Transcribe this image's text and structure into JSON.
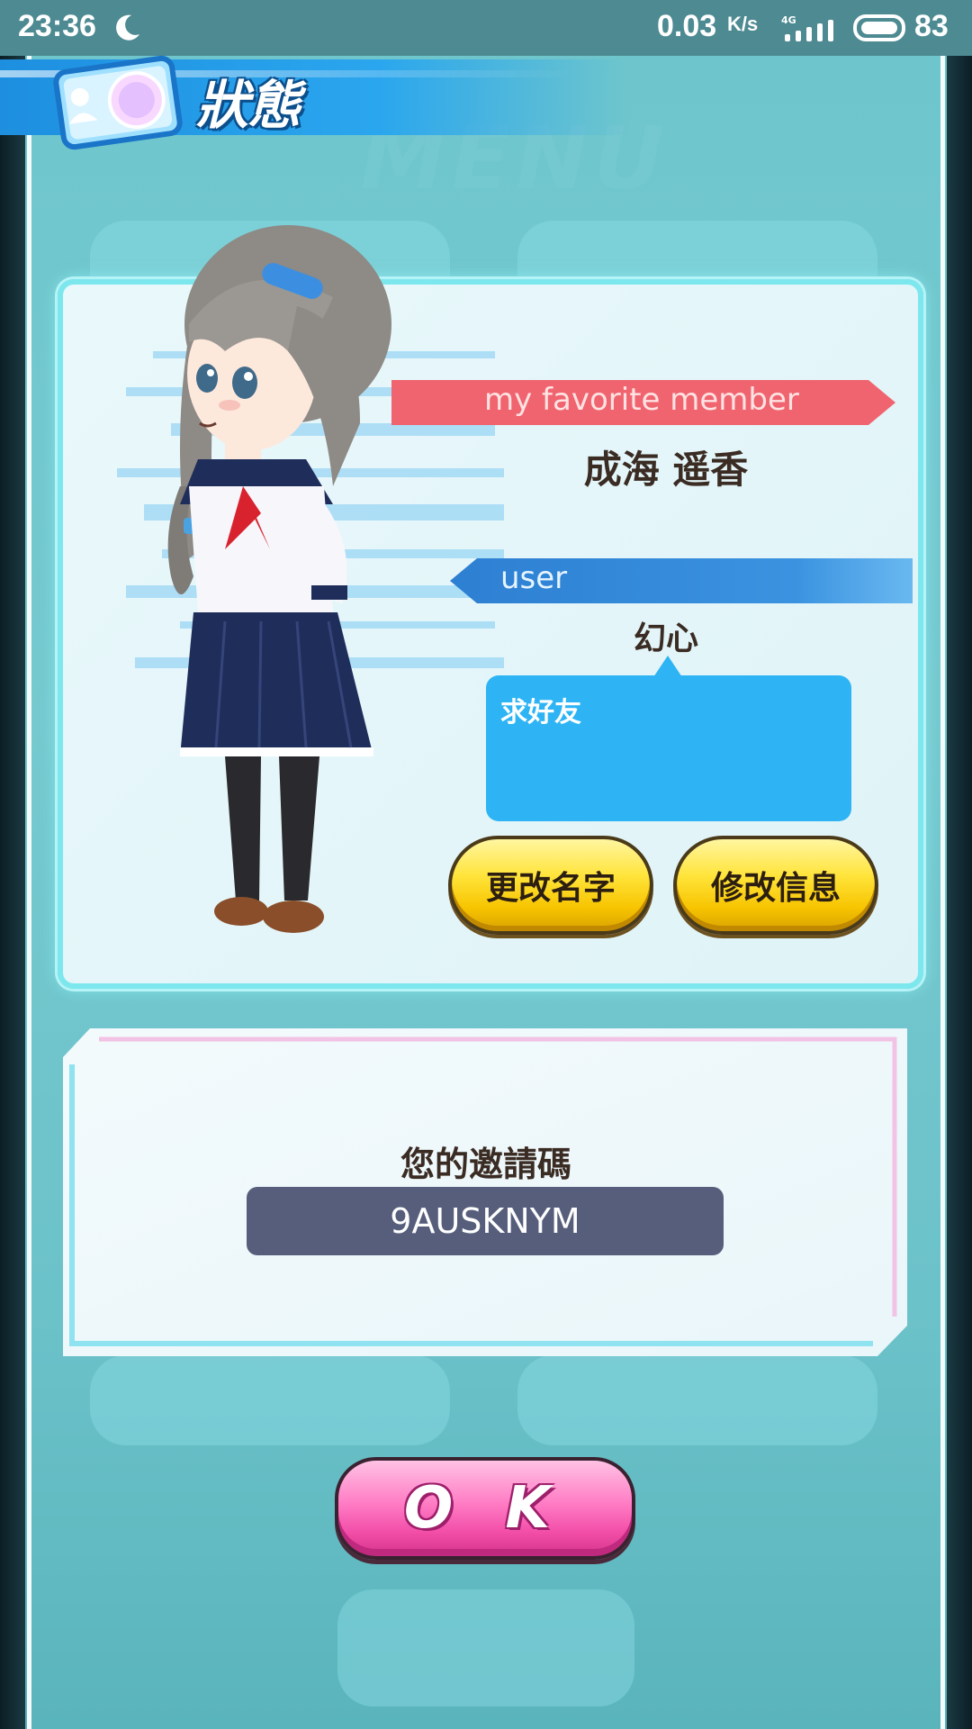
{
  "status_bar": {
    "time": "23:36",
    "speed": "0.03",
    "speed_unit": "K/s",
    "battery": "83"
  },
  "header": {
    "title": "狀態"
  },
  "profile": {
    "favorite_label": "my favorite member",
    "favorite_name": "成海 遥香",
    "user_label": "user",
    "user_name": "幻心",
    "message": "求好友",
    "change_name_button": "更改名字",
    "edit_info_button": "修改信息"
  },
  "invite": {
    "title": "您的邀請碼",
    "code": "9AUSKNYM"
  },
  "ok_button": "O K",
  "colors": {
    "favorite_banner": "#f06470",
    "user_banner": "#2d7fd2",
    "message_bubble": "#2eb4f4",
    "ok_pink": "#f24ea8",
    "button_yellow": "#ffe43a"
  }
}
